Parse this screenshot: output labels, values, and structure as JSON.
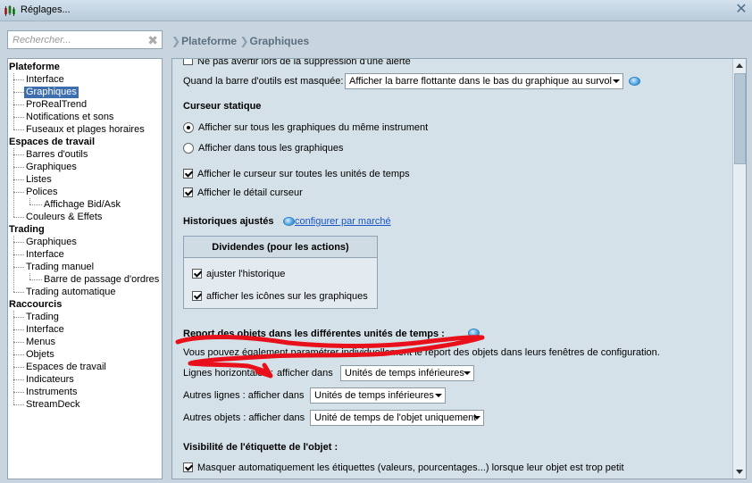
{
  "window": {
    "title": "Réglages..."
  },
  "search": {
    "placeholder": "Rechercher..."
  },
  "breadcrumb": [
    "Plateforme",
    "Graphiques"
  ],
  "tree": {
    "plateforme": {
      "label": "Plateforme",
      "items": [
        "Interface",
        "Graphiques",
        "ProRealTrend",
        "Notifications et sons",
        "Fuseaux et plages horaires"
      ]
    },
    "espaces": {
      "label": "Espaces de travail",
      "items": [
        "Barres d'outils",
        "Graphiques",
        "Listes",
        "Polices",
        "Affichage Bid/Ask",
        "Couleurs & Effets"
      ]
    },
    "trading": {
      "label": "Trading",
      "items": [
        "Graphiques",
        "Interface",
        "Trading manuel",
        "Barre de passage d'ordres",
        "Trading automatique"
      ]
    },
    "raccourcis": {
      "label": "Raccourcis",
      "items": [
        "Trading",
        "Interface",
        "Menus",
        "Objets",
        "Espaces de travail",
        "Indicateurs",
        "Instruments",
        "StreamDeck"
      ]
    }
  },
  "content": {
    "top_cut_text": "Ne pas avertir lors de la suppression d'une alerte",
    "toolbar_hidden_label": "Quand la barre d'outils est masquée:",
    "toolbar_hidden_value": "Afficher la barre flottante dans le bas du graphique au survol",
    "curseur_statique": {
      "title": "Curseur statique",
      "radio1": "Afficher sur tous les graphiques du même instrument",
      "radio2": "Afficher dans tous les graphiques",
      "check1": "Afficher le curseur sur toutes les unités de temps",
      "check2": "Afficher le détail curseur"
    },
    "historiques": {
      "title": "Historiques ajustés",
      "link": "configurer par marché",
      "box_title": "Dividendes (pour les actions)",
      "check1": "ajuster l'historique",
      "check2": "afficher les icônes sur les graphiques"
    },
    "report": {
      "title": "Report des objets dans les différentes unités de temps :",
      "desc": "Vous pouvez également paramétrer individuellement le report des objets dans leurs fenêtres de configuration.",
      "row1_label": "Lignes horizontales :",
      "row1_mid": "afficher dans",
      "row1_value": "Unités de temps inférieures",
      "row2_label": "Autres lignes : afficher dans",
      "row2_value": "Unités de temps inférieures",
      "row3_label": "Autres objets : afficher dans",
      "row3_value": "Unité de temps de l'objet uniquement"
    },
    "visibilite": {
      "title": "Visibilité de l'étiquette de l'objet :",
      "check1": "Masquer automatiquement les étiquettes (valeurs, pourcentages...) lorsque leur objet est trop petit"
    },
    "annotation_color": "#e8101a"
  }
}
